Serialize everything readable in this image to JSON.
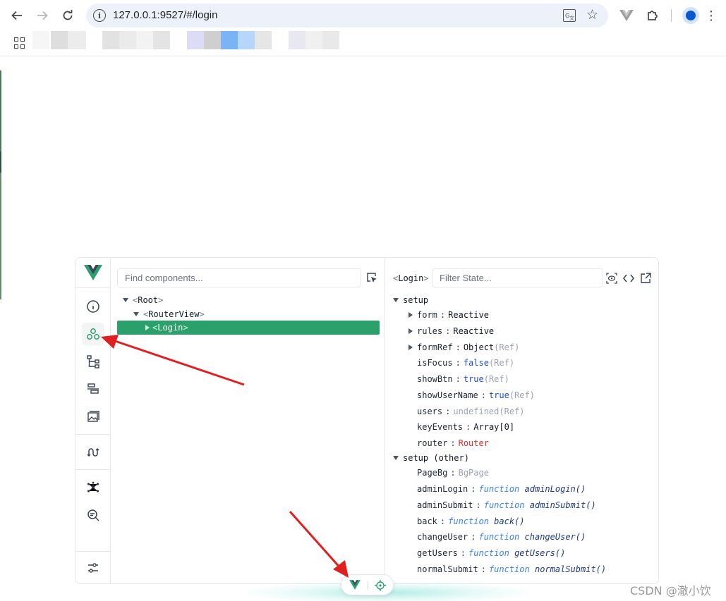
{
  "browser": {
    "url": "127.0.0.1:9527/#/login",
    "colors": {
      "toolbar_bg": "#ffffff",
      "omnibox_bg": "#edf1f9",
      "profile_accent": "#0b57d0"
    },
    "icons": [
      "back-icon",
      "forward-icon",
      "reload-icon",
      "info-icon",
      "translate-icon",
      "bookmark-star-icon",
      "vue-extension-icon",
      "extensions-puzzle-icon",
      "profile-icon",
      "menu-dots-icon",
      "apps-grid-icon"
    ]
  },
  "devtools": {
    "accent": "#2aa06b",
    "rail_icons": [
      "vue-logo-icon",
      "info-icon",
      "components-icon",
      "component-tree-icon",
      "timeline-icon",
      "assets-icon",
      "router-icon",
      "graph-icon",
      "inspect-search-icon",
      "settings-icon"
    ],
    "tree": {
      "search_placeholder": "Find components...",
      "nodes": [
        {
          "open": "<",
          "name": "Root",
          "close": ">"
        },
        {
          "open": "<",
          "name": "RouterView",
          "close": ">"
        },
        {
          "open": "<",
          "name": "Login",
          "close": ">"
        }
      ]
    },
    "inspector": {
      "component": {
        "open": "<",
        "name": "Login",
        "close": ">"
      },
      "filter_placeholder": "Filter State...",
      "sections": [
        {
          "label": "setup",
          "rows": [
            {
              "key": "form",
              "value": "Reactive",
              "suffix": ""
            },
            {
              "key": "rules",
              "value": "Reactive",
              "suffix": ""
            },
            {
              "key": "formRef",
              "value": "Object",
              "suffix": "(Ref)"
            },
            {
              "key": "isFocus",
              "value": "false",
              "suffix": "(Ref)"
            },
            {
              "key": "showBtn",
              "value": "true",
              "suffix": "(Ref)"
            },
            {
              "key": "showUserName",
              "value": "true",
              "suffix": "(Ref)"
            },
            {
              "key": "users",
              "value": "undefined",
              "suffix": "(Ref)"
            },
            {
              "key": "keyEvents",
              "value": "Array[0]",
              "suffix": ""
            },
            {
              "key": "router",
              "value": "Router",
              "suffix": ""
            }
          ]
        },
        {
          "label": "setup (other)",
          "rows": [
            {
              "key": "PageBg",
              "value": "BgPage"
            },
            {
              "key": "adminLogin",
              "kw": "function",
              "fn": "adminLogin()"
            },
            {
              "key": "adminSubmit",
              "kw": "function",
              "fn": "adminSubmit()"
            },
            {
              "key": "back",
              "kw": "function",
              "fn": "back()"
            },
            {
              "key": "changeUser",
              "kw": "function",
              "fn": "changeUser()"
            },
            {
              "key": "getUsers",
              "kw": "function",
              "fn": "getUsers()"
            },
            {
              "key": "normalSubmit",
              "kw": "function",
              "fn": "normalSubmit()"
            }
          ]
        }
      ],
      "colon": ":"
    }
  },
  "watermark": "CSDN @澈小饮"
}
